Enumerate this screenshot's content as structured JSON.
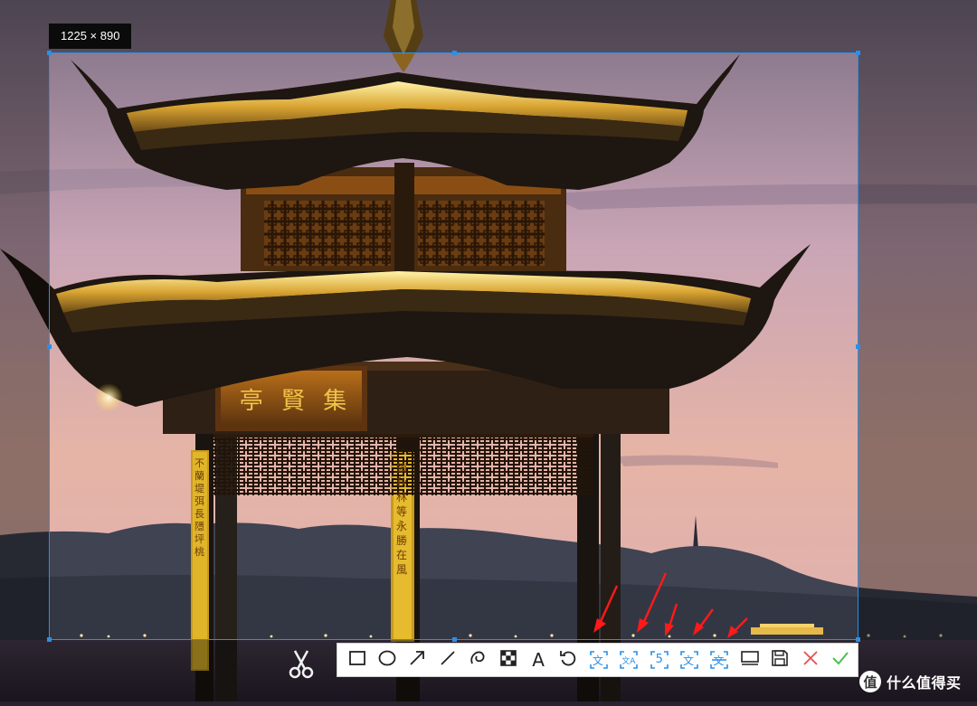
{
  "selection": {
    "size_label": "1225 × 890"
  },
  "signboard": {
    "text": "亭 賢 集"
  },
  "pillar_text": {
    "left": "不 蘭 堤 弭 長 隱 坪 桃",
    "right": "鎖 秋 林 等 永 勝 在 風"
  },
  "toolbar": {
    "items": [
      {
        "name": "rectangle-tool",
        "icon": "rectangle-icon"
      },
      {
        "name": "ellipse-tool",
        "icon": "ellipse-icon"
      },
      {
        "name": "arrow-tool",
        "icon": "arrow-icon"
      },
      {
        "name": "line-tool",
        "icon": "line-icon"
      },
      {
        "name": "pen-tool",
        "icon": "pen-icon"
      },
      {
        "name": "mosaic-tool",
        "icon": "mosaic-icon"
      },
      {
        "name": "text-tool",
        "icon": "text-icon",
        "label": "A"
      },
      {
        "name": "undo-button",
        "icon": "undo-icon"
      },
      {
        "name": "ocr-button",
        "icon": "ocr-text-icon",
        "label": "文"
      },
      {
        "name": "translate-button",
        "icon": "translate-icon",
        "label": "文A"
      },
      {
        "name": "sequence-button",
        "icon": "sequence-icon",
        "label": "5"
      },
      {
        "name": "text-recognition-button",
        "icon": "text-recognition-icon",
        "label": "文"
      },
      {
        "name": "long-screenshot-button",
        "icon": "long-screenshot-icon",
        "label": "文"
      },
      {
        "name": "pin-button",
        "icon": "pin-icon"
      },
      {
        "name": "save-button",
        "icon": "save-icon"
      },
      {
        "name": "cancel-button",
        "icon": "close-icon"
      },
      {
        "name": "confirm-button",
        "icon": "check-icon"
      }
    ],
    "accent": "#2b8fe6",
    "cancel_color": "#e25050",
    "confirm_color": "#4cc04c"
  },
  "watermark": {
    "symbol": "值",
    "text": "什么值得买"
  }
}
